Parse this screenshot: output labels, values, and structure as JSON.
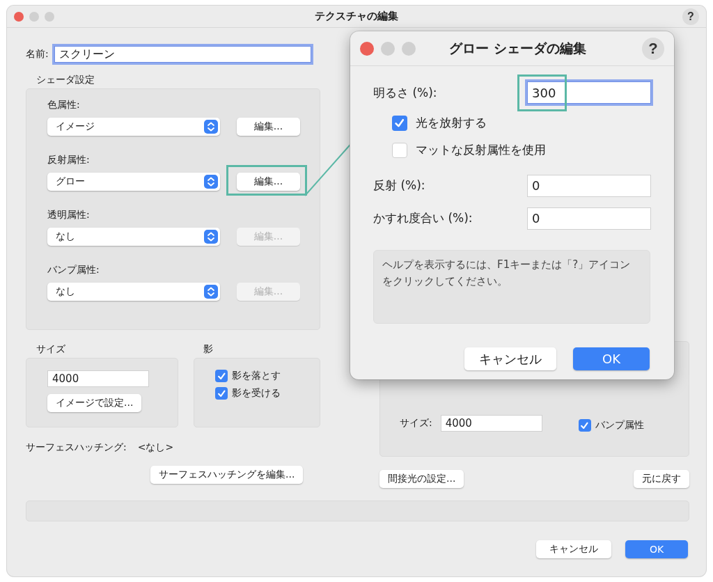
{
  "window": {
    "title": "テクスチャの編集",
    "help": "?"
  },
  "name": {
    "label": "名前:",
    "value": "スクリーン"
  },
  "shader_settings": {
    "title": "シェーダ設定",
    "attributes": [
      {
        "label": "色属性:",
        "value": "イメージ",
        "button": "編集...",
        "disabled": false,
        "highlighted": false
      },
      {
        "label": "反射属性:",
        "value": "グロー",
        "button": "編集...",
        "disabled": false,
        "highlighted": true
      },
      {
        "label": "透明属性:",
        "value": "なし",
        "button": "編集...",
        "disabled": true,
        "highlighted": false
      },
      {
        "label": "バンプ属性:",
        "value": "なし",
        "button": "編集...",
        "disabled": true,
        "highlighted": false
      }
    ]
  },
  "size": {
    "title": "サイズ",
    "value": "4000",
    "button": "イメージで設定..."
  },
  "shadow": {
    "title": "影",
    "options": [
      {
        "label": "影を落とす",
        "checked": true
      },
      {
        "label": "影を受ける",
        "checked": true
      }
    ]
  },
  "surface_hatching": {
    "label": "サーフェスハッチング:",
    "value": "<なし>",
    "button": "サーフェスハッチングを編集..."
  },
  "right_panel": {
    "size_label": "サイズ:",
    "size_value": "4000",
    "options": [
      {
        "label": "バンプ属性",
        "checked": true
      }
    ],
    "indirect_button": "間接光の設定...",
    "revert_button": "元に戻す"
  },
  "buttons": [
    {
      "label": "キャンセル",
      "primary": false
    },
    {
      "label": "OK",
      "primary": true
    }
  ],
  "dialog": {
    "title": "グロー シェーダの編集",
    "help": "?",
    "rows": [
      {
        "kind": "field",
        "label": "明るさ (%):",
        "value": "300",
        "focused": true,
        "highlighted": true
      },
      {
        "kind": "checkbox",
        "label": "光を放射する",
        "checked": true
      },
      {
        "kind": "checkbox",
        "label": "マットな反射属性を使用",
        "checked": false
      },
      {
        "kind": "field",
        "label": "反射 (%):",
        "value": "0",
        "focused": false,
        "highlighted": false
      },
      {
        "kind": "field",
        "label": "かすれ度合い (%):",
        "value": "0",
        "focused": false,
        "highlighted": false
      }
    ],
    "help_text": "ヘルプを表示するには、F1キーまたは「?」アイコンをクリックしてください。",
    "buttons": [
      {
        "label": "キャンセル",
        "primary": false
      },
      {
        "label": "OK",
        "primary": true
      }
    ]
  }
}
